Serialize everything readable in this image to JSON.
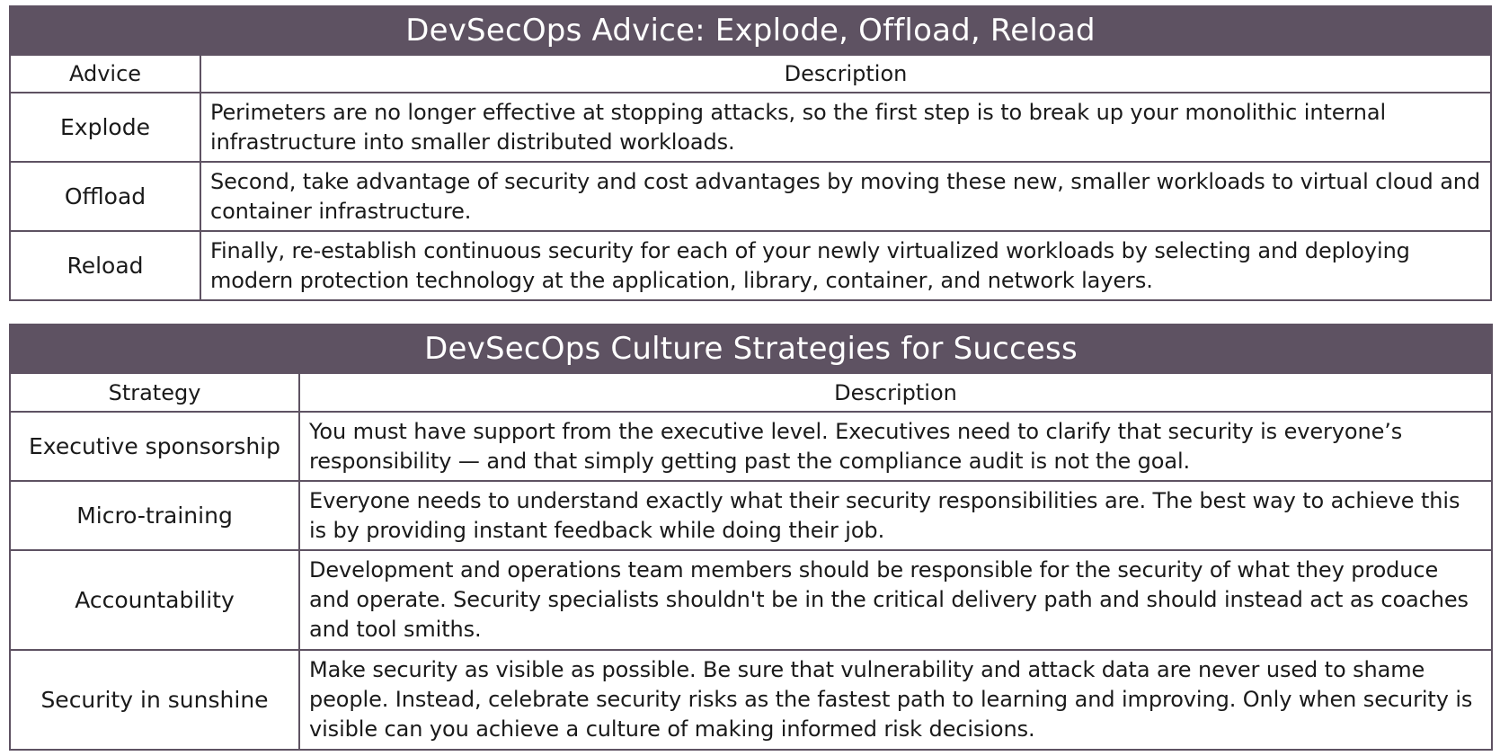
{
  "advice_table": {
    "title": "DevSecOps Advice: Explode, Offload, Reload",
    "header_advice": "Advice",
    "header_description": "Description",
    "rows": [
      {
        "label": "Explode",
        "description": "Perimeters are no longer effective at stopping attacks, so the first step is to break up your monolithic internal infrastructure into smaller distributed workloads."
      },
      {
        "label": "Offload",
        "description": "Second, take advantage of security and cost advantages by moving these new, smaller workloads to virtual cloud and container infrastructure."
      },
      {
        "label": "Reload",
        "description": "Finally, re-establish continuous security for each of your newly virtualized workloads by selecting and deploying modern protection technology at the application, library, container, and network layers."
      }
    ]
  },
  "culture_table": {
    "title": "DevSecOps Culture Strategies for Success",
    "header_strategy": "Strategy",
    "header_description": "Description",
    "rows": [
      {
        "label": "Executive sponsorship",
        "description": "You must have support from the executive level. Executives need to clarify that security is everyone’s responsibility — and that simply getting past the compliance audit is not the goal."
      },
      {
        "label": "Micro-training",
        "description": "Everyone needs to understand exactly what their security responsibilities are. The best way to achieve this is by providing instant feedback while doing their job."
      },
      {
        "label": "Accountability",
        "description": "Development and operations team members should be responsible for the security of what they produce and operate. Security specialists shouldn't be in the critical delivery path and should instead act as coaches and tool smiths."
      },
      {
        "label": "Security in sunshine",
        "description": "Make security as visible as possible. Be sure that vulnerability and attack data are never used to shame people. Instead, celebrate security risks as the fastest path to learning and improving. Only when security is visible can you achieve a culture of making informed risk decisions."
      }
    ]
  },
  "colors": {
    "banner_background": "#5e5262",
    "banner_text": "#ffffff",
    "border": "#5e5262"
  }
}
